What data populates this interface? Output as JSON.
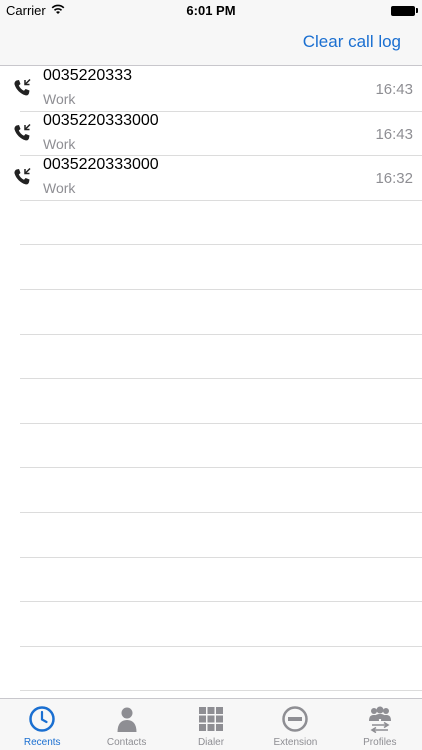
{
  "status_bar": {
    "carrier": "Carrier",
    "time": "6:01 PM"
  },
  "nav": {
    "clear_label": "Clear call log",
    "accent_color": "#1a6fd1"
  },
  "calls": [
    {
      "number": "0035220333",
      "type": "Work",
      "time": "16:43"
    },
    {
      "number": "0035220333000",
      "type": "Work",
      "time": "16:43"
    },
    {
      "number": "0035220333000",
      "type": "Work",
      "time": "16:32"
    }
  ],
  "tabs": [
    {
      "label": "Recents",
      "icon": "clock-icon",
      "active": true
    },
    {
      "label": "Contacts",
      "icon": "person-icon",
      "active": false
    },
    {
      "label": "Dialer",
      "icon": "keypad-icon",
      "active": false
    },
    {
      "label": "Extension",
      "icon": "minus-circle-icon",
      "active": false
    },
    {
      "label": "Profiles",
      "icon": "profiles-icon",
      "active": false
    }
  ]
}
